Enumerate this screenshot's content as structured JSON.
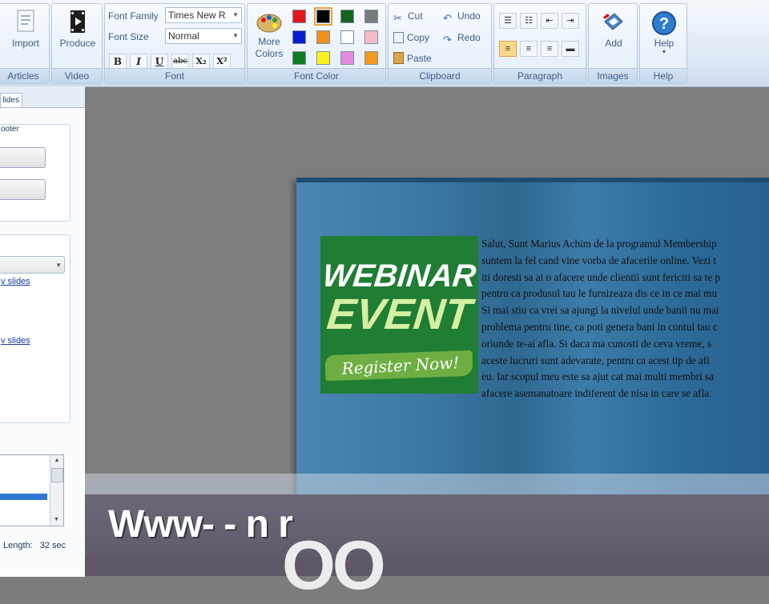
{
  "ribbon": {
    "articles": {
      "import_label": "Import",
      "group_label": "Articles"
    },
    "video": {
      "produce_label": "Produce",
      "group_label": "Video"
    },
    "font": {
      "family_label": "Font Family",
      "family_value": "Times New R",
      "size_label": "Font Size",
      "size_value": "Normal",
      "format_buttons": [
        "B",
        "I",
        "U",
        "abc",
        "X₂",
        "X²"
      ],
      "group_label": "Font"
    },
    "font_color": {
      "more_label_1": "More",
      "more_label_2": "Colors",
      "swatches": [
        "#e3171b",
        "#000000",
        "#16651f",
        "#7b7b7b",
        "#0a1dd1",
        "#f0901c",
        "#ffffff",
        "#f6bdc7",
        "#0e7c1f",
        "#fcf11d",
        "#e58be2",
        "#f39b1f"
      ],
      "selected": "#000000",
      "group_label": "Font Color"
    },
    "clipboard": {
      "cut_label": "Cut",
      "copy_label": "Copy",
      "paste_label": "Paste",
      "undo_label": "Undo",
      "redo_label": "Redo",
      "group_label": "Clipboard"
    },
    "paragraph": {
      "group_label": "Paragraph"
    },
    "images": {
      "add_label": "Add",
      "group_label": "Images"
    },
    "help": {
      "help_label": "Help",
      "group_label": "Help"
    }
  },
  "left_panel": {
    "tab_label": "lides",
    "header_text": "ooter",
    "link1": "v slides",
    "link2": "v slides",
    "length_label": "Length:",
    "length_value": "32 sec"
  },
  "slide": {
    "banner_line1": "WEBINAR",
    "banner_line2": "EVENT",
    "banner_line3": "Register Now!",
    "text_lines": [
      "Salut, Sunt Marius Achim de la programul Membership",
      "suntem la fel cand vine vorba de afacerile online. Vezi t",
      "iti doresti sa ai o afacere unde clientii sunt fericiti sa te p",
      "pentru ca produsul tau le furnizeaza dis ce in ce mai mu",
      "Si mai stiu ca vrei sa ajungi la nivelul unde banii nu mai",
      "problema pentru tine, ca poti genera bani in contul tau c",
      "oriunde te-ai afla. Si daca ma cunosti de ceva vreme, s",
      "aceste lucruri sunt adevarate, pentru ca acest tip de afi",
      "eu. Iar scopul meu este sa ajut cat mai multi membri sa",
      "afacere asemanatoare indiferent de nisa in care se afla."
    ]
  },
  "overlay": {
    "www_text": "Www- - n r",
    "big_text": "OO"
  }
}
